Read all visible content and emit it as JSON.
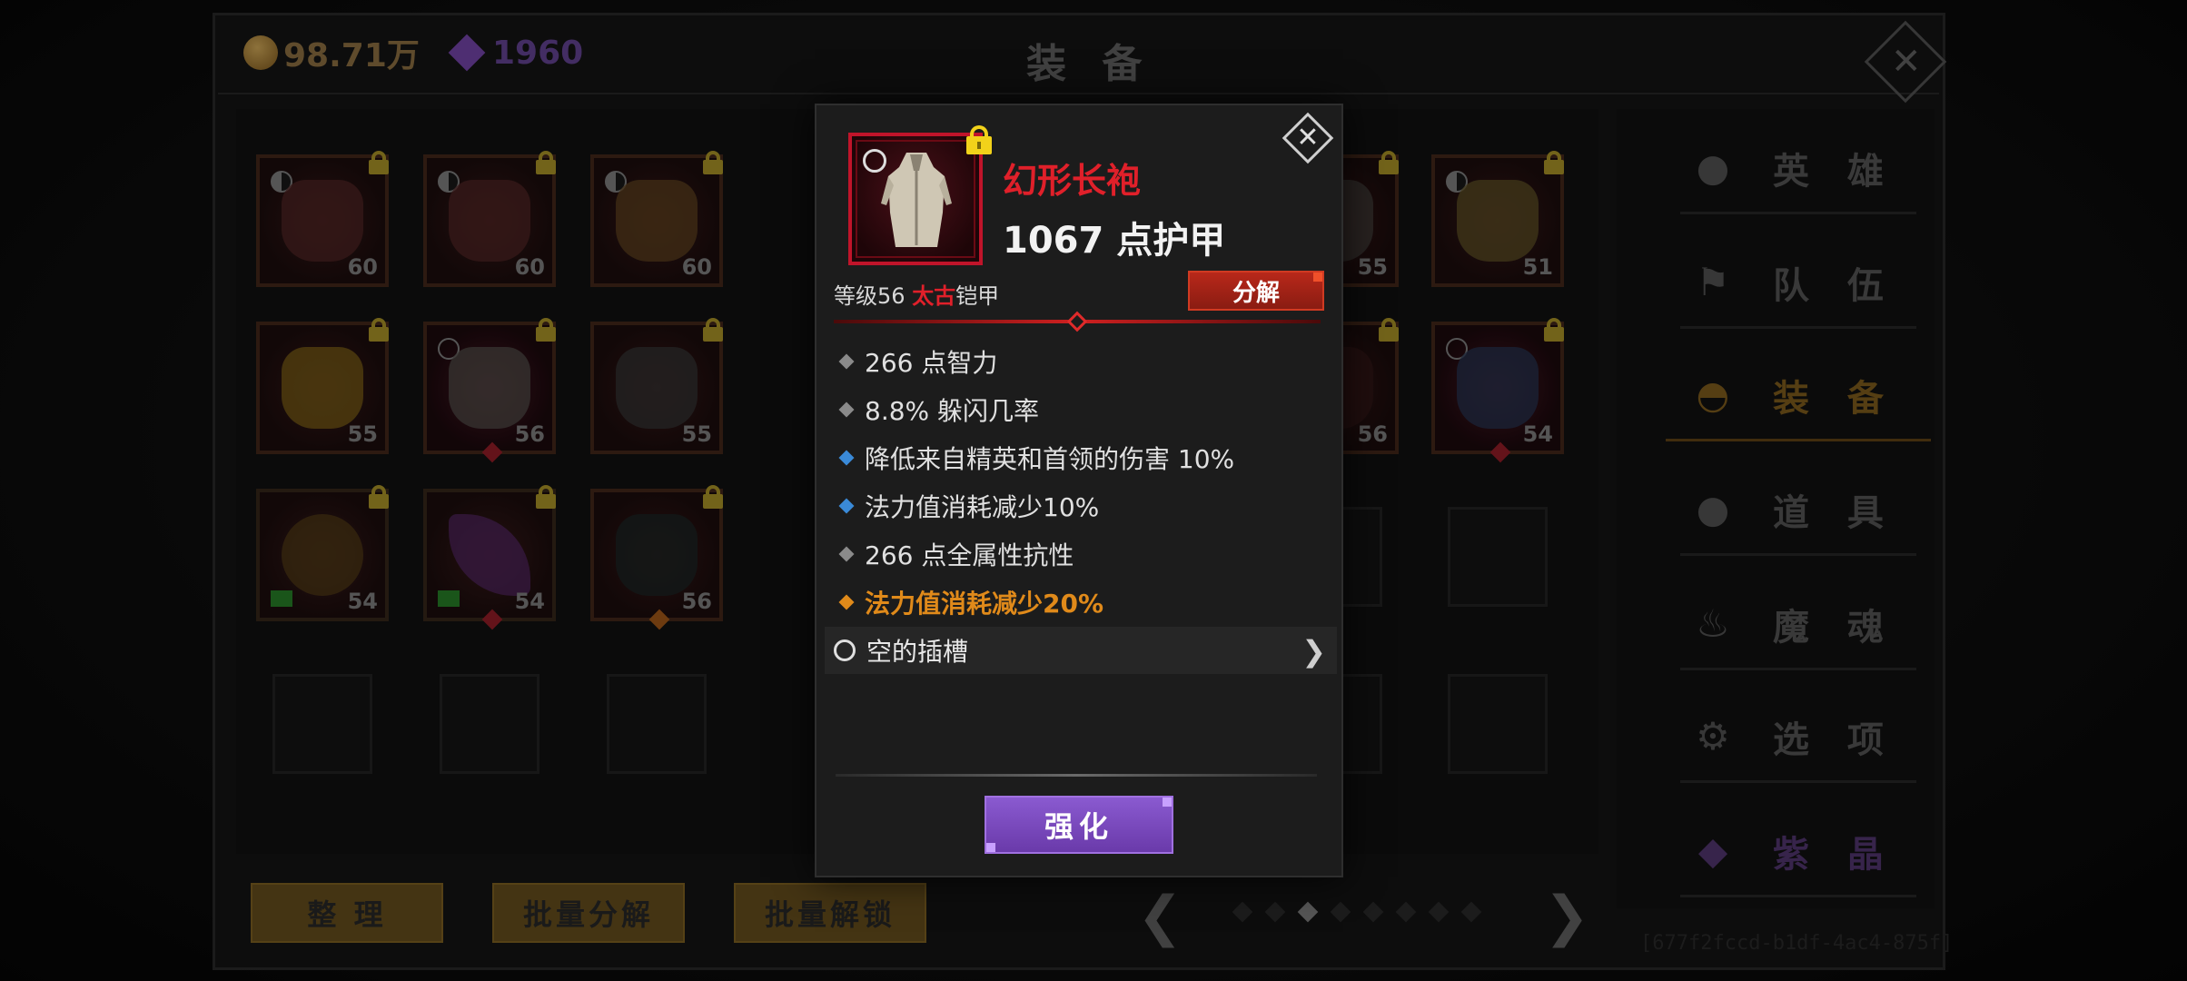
{
  "topbar": {
    "gold": "98.71万",
    "gems": "1960",
    "title": "装 备"
  },
  "grid": {
    "levels": [
      "60",
      "60",
      "60",
      "55",
      "51",
      "55",
      "56",
      "55",
      "56",
      "54",
      "54",
      "54",
      "56"
    ]
  },
  "buttons": {
    "sort": "整 理",
    "batch_salvage": "批量分解",
    "batch_unlock": "批量解锁"
  },
  "uuid": "[677f2fccd-b1df-4ac4-875f]",
  "side_menu": {
    "items": [
      {
        "label": "英 雄",
        "icon": "heroes-icon"
      },
      {
        "label": "队 伍",
        "icon": "flag-icon"
      },
      {
        "label": "装 备",
        "icon": "helmet-icon"
      },
      {
        "label": "道 具",
        "icon": "bag-icon"
      },
      {
        "label": "魔 魂",
        "icon": "flame-icon"
      },
      {
        "label": "选 项",
        "icon": "gear-icon"
      },
      {
        "label": "紫 晶",
        "icon": "crystal-icon"
      }
    ],
    "active": "装 备"
  },
  "dialog": {
    "item_name": "幻形长袍",
    "armor": "1067 点护甲",
    "level_prefix": "等级56",
    "grade": "太古",
    "type": "铠甲",
    "salvage": "分解",
    "stats": [
      {
        "text": "266 点智力",
        "bullet": "grey"
      },
      {
        "text": "8.8% 躲闪几率",
        "bullet": "grey"
      },
      {
        "text": "降低来自精英和首领的伤害 10%",
        "bullet": "blue"
      },
      {
        "text": "法力值消耗减少10%",
        "bullet": "blue"
      },
      {
        "text": "266 点全属性抗性",
        "bullet": "grey"
      },
      {
        "text": "法力值消耗减少20%",
        "bullet": "orange"
      }
    ],
    "socket": "空的插槽",
    "enhance": "强化",
    "colors": {
      "name_red": "#e0202a",
      "legend_orange": "#e08a1a",
      "magic_blue": "#3a8ad8",
      "lock_yellow": "#f2d21a",
      "enhance_purple": "#7a4ac0"
    }
  }
}
